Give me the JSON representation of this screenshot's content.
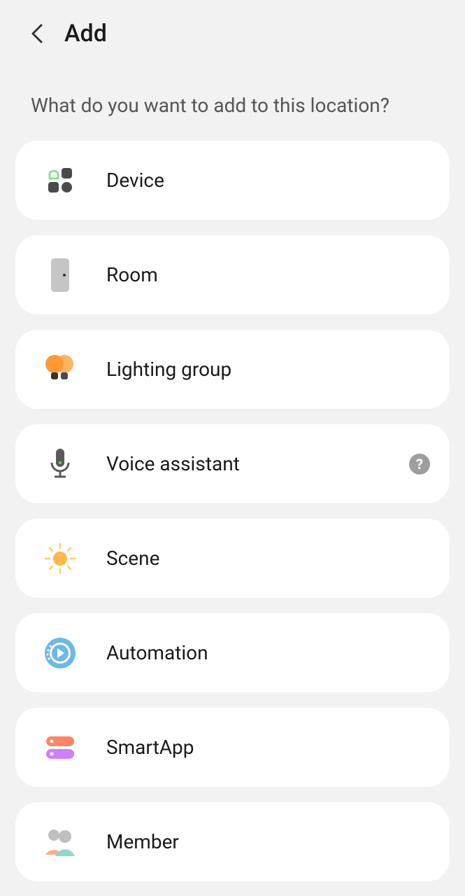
{
  "header": {
    "title": "Add"
  },
  "prompt": "What do you want to add to this location?",
  "items": [
    {
      "label": "Device",
      "icon": "device",
      "hasHelp": false
    },
    {
      "label": "Room",
      "icon": "room",
      "hasHelp": false
    },
    {
      "label": "Lighting group",
      "icon": "lighting",
      "hasHelp": false
    },
    {
      "label": "Voice assistant",
      "icon": "voice",
      "hasHelp": true
    },
    {
      "label": "Scene",
      "icon": "scene",
      "hasHelp": false
    },
    {
      "label": "Automation",
      "icon": "automation",
      "hasHelp": false
    },
    {
      "label": "SmartApp",
      "icon": "smartapp",
      "hasHelp": false
    },
    {
      "label": "Member",
      "icon": "member",
      "hasHelp": false
    }
  ]
}
